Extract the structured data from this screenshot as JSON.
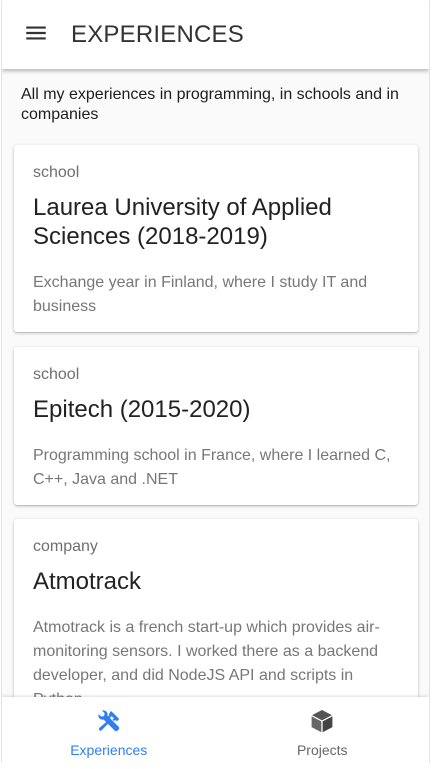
{
  "appbar": {
    "title": "EXPERIENCES",
    "menu_icon": "hamburger-menu-icon"
  },
  "intro": "All my experiences in programming, in schools and in companies",
  "experiences": [
    {
      "type": "school",
      "title": "Laurea University of Applied Sciences (2018-2019)",
      "description": "Exchange year in Finland, where I study IT and business"
    },
    {
      "type": "school",
      "title": "Epitech (2015-2020)",
      "description": "Programming school in France, where I learned C, C++, Java and .NET"
    },
    {
      "type": "company",
      "title": "Atmotrack",
      "description": "Atmotrack is a french start-up which provides air-monitoring sensors. I worked there as a backend developer, and did NodeJS API and scripts in Python"
    }
  ],
  "bottom_nav": {
    "items": [
      {
        "label": "Experiences",
        "icon": "tools-icon",
        "active": true
      },
      {
        "label": "Projects",
        "icon": "cube-icon",
        "active": false
      }
    ]
  },
  "colors": {
    "accent": "#2f7ff0",
    "inactive": "#666666",
    "appbar_bg": "#ffffff",
    "page_bg": "#fafafa"
  }
}
